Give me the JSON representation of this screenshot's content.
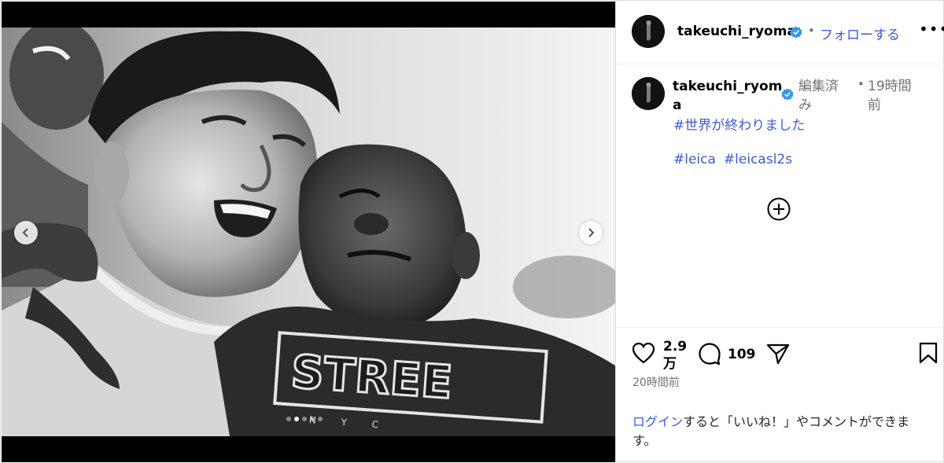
{
  "post": {
    "username": "takeuchi_ryoma",
    "verified": true,
    "follow_label": "フォローする",
    "separator": "•",
    "more_label": "•••",
    "caption": {
      "username": "takeuchi_ryoma",
      "edited_label": "編集済み",
      "separator": "•",
      "time_ago": "19時間前",
      "hashtag_line1": "#世界が終わりました",
      "hashtags": [
        "#leica",
        "#leicasl2s"
      ]
    },
    "likes": "2.9万",
    "comments_count": "109",
    "posted_time": "20時間前",
    "login_prompt": {
      "link_text": "ログイン",
      "rest_text": "すると「いいね！」やコメントができます。"
    },
    "carousel": {
      "dot_count": 5,
      "active_index": 1
    }
  },
  "photo": {
    "description_tag": "",
    "shirt_text": "STREE",
    "shirt_subtext": "N Y C"
  },
  "colors": {
    "accent": "#3b5bdb",
    "secondary_text": "#737373",
    "verified": "#3897f0",
    "border": "#dbdbdb"
  },
  "icons": {
    "prev": "chevron-left-icon",
    "next": "chevron-right-icon",
    "verified": "verified-badge-icon",
    "more": "more-icon",
    "add": "add-circle-icon",
    "like": "heart-icon",
    "comment": "comment-icon",
    "share": "share-icon",
    "save": "bookmark-icon"
  }
}
